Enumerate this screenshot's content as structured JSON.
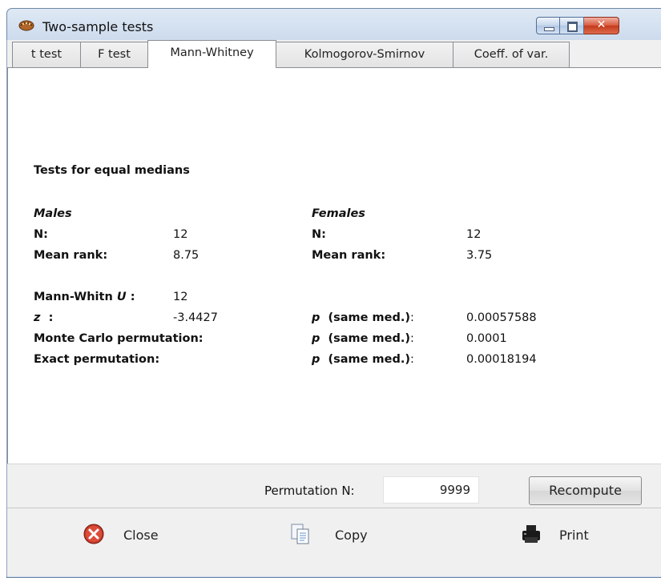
{
  "window": {
    "title": "Two-sample tests",
    "close_glyph": "✕"
  },
  "tabs": [
    {
      "label": "t test"
    },
    {
      "label": "F test"
    },
    {
      "label": "Mann-Whitney"
    },
    {
      "label": "Kolmogorov-Smirnov"
    },
    {
      "label": "Coeff. of var."
    }
  ],
  "active_tab": "Mann-Whitney",
  "results": {
    "heading": "Tests for equal medians",
    "group1": {
      "name": "Males",
      "n_label": "N:",
      "n_value": "12",
      "rank_label": "Mean rank:",
      "rank_value": "8.75"
    },
    "group2": {
      "name": "Females",
      "n_label": "N:",
      "n_value": "12",
      "rank_label": "Mean rank:",
      "rank_value": "3.75"
    },
    "u_label": "Mann-Whitn",
    "u_symbol": "U",
    "u_colon": ":",
    "u_value": "12",
    "z_label": "z",
    "z_colon": ":",
    "z_value": "-3.4427",
    "p_symbol": "p",
    "p_label": "(same med.)",
    "p_colon": ":",
    "p_z_value": "0.00057588",
    "monte_carlo_label": "Monte Carlo permutation:",
    "p_monte_carlo_value": "0.0001",
    "exact_label": "Exact permutation:",
    "p_exact_value": "0.00018194"
  },
  "permutation": {
    "label": "Permutation N:",
    "value": "9999",
    "recompute_label": "Recompute"
  },
  "buttons": {
    "close": "Close",
    "copy": "Copy",
    "print": "Print"
  },
  "colors": {
    "close_red": "#c0392b",
    "titlebar": "#c7d7eb",
    "face": "#f0f0f0"
  }
}
